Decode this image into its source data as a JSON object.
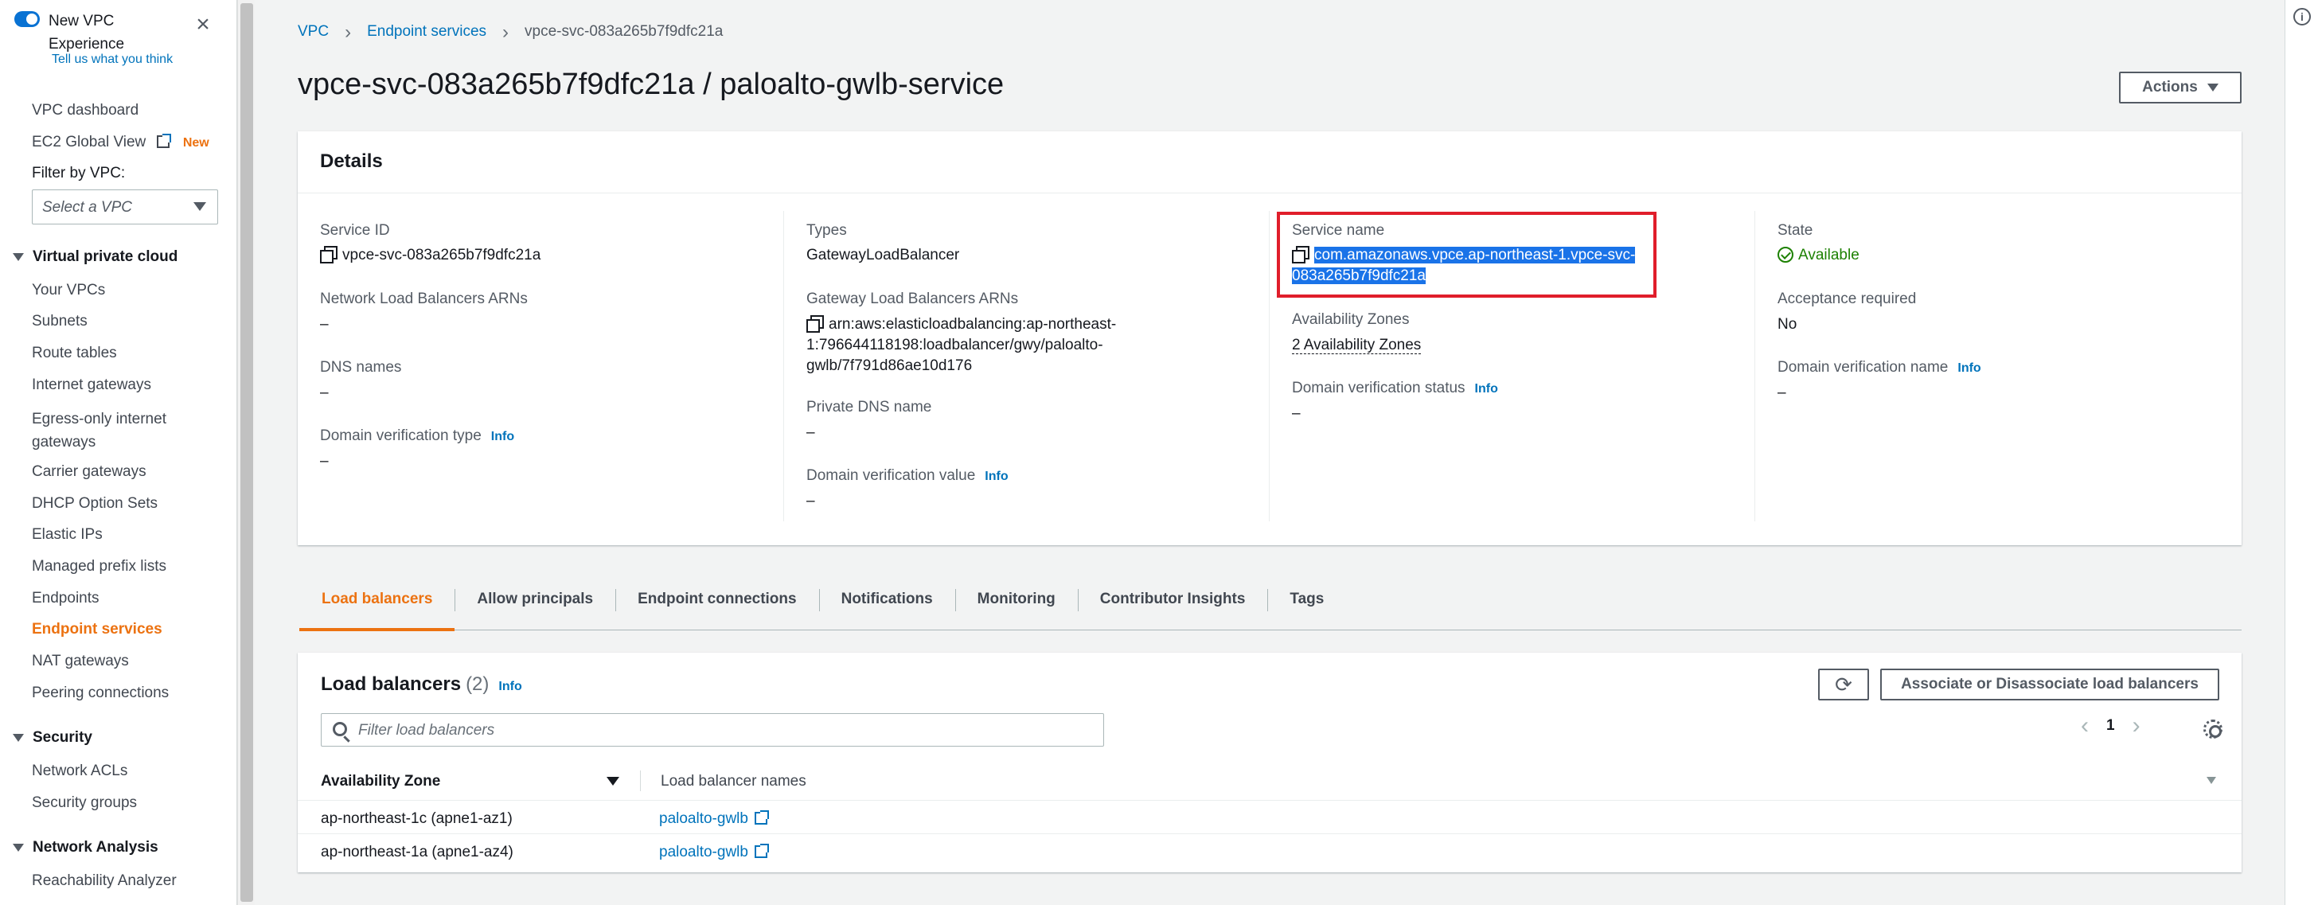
{
  "sidebar": {
    "toggle_label": "New VPC Experience",
    "feedback": "Tell us what you think",
    "items": {
      "dashboard": "VPC dashboard",
      "ec2_global": "EC2 Global View",
      "new_badge": "New",
      "filter_label": "Filter by VPC:",
      "filter_placeholder": "Select a VPC",
      "section_vpc": "Virtual private cloud",
      "your_vpcs": "Your VPCs",
      "subnets": "Subnets",
      "route_tables": "Route tables",
      "igw": "Internet gateways",
      "egress_igw": "Egress-only internet gateways",
      "carrier": "Carrier gateways",
      "dhcp": "DHCP Option Sets",
      "eips": "Elastic IPs",
      "prefix": "Managed prefix lists",
      "endpoints": "Endpoints",
      "endpoint_services": "Endpoint services",
      "nat": "NAT gateways",
      "peering": "Peering connections",
      "section_security": "Security",
      "nacls": "Network ACLs",
      "sgs": "Security groups",
      "section_network": "Network Analysis",
      "reachability": "Reachability Analyzer"
    }
  },
  "breadcrumb": {
    "vpc": "VPC",
    "endpoint_services": "Endpoint services",
    "current": "vpce-svc-083a265b7f9dfc21a"
  },
  "page_title": "vpce-svc-083a265b7f9dfc21a / paloalto-gwlb-service",
  "actions_label": "Actions",
  "details": {
    "header": "Details",
    "info": "Info",
    "service_id_label": "Service ID",
    "service_id": "vpce-svc-083a265b7f9dfc21a",
    "nlb_arns_label": "Network Load Balancers ARNs",
    "nlb_arns": "–",
    "dns_names_label": "DNS names",
    "dns_names": "–",
    "dv_type_label": "Domain verification type",
    "dv_type": "–",
    "types_label": "Types",
    "types": "GatewayLoadBalancer",
    "gwlb_arns_label": "Gateway Load Balancers ARNs",
    "gwlb_arns_1": "arn:aws:elasticloadbalancing:ap-northeast-",
    "gwlb_arns_2": "1:796644118198:loadbalancer/gwy/paloalto-",
    "gwlb_arns_3": "gwlb/7f791d86ae10d176",
    "private_dns_label": "Private DNS name",
    "private_dns": "–",
    "dv_value_label": "Domain verification value",
    "dv_value": "–",
    "service_name_label": "Service name",
    "service_name_1": "com.amazonaws.vpce.ap-northeast-1.vpce-svc-",
    "service_name_2": "083a265b7f9dfc21a",
    "az_label": "Availability Zones",
    "az": "2 Availability Zones",
    "dv_status_label": "Domain verification status",
    "dv_status": "–",
    "state_label": "State",
    "state": "Available",
    "acceptance_label": "Acceptance required",
    "acceptance": "No",
    "dv_name_label": "Domain verification name",
    "dv_name": "–"
  },
  "tabs": [
    "Load balancers",
    "Allow principals",
    "Endpoint connections",
    "Notifications",
    "Monitoring",
    "Contributor Insights",
    "Tags"
  ],
  "lb": {
    "title": "Load balancers",
    "count": "(2)",
    "info": "Info",
    "associate_label": "Associate or Disassociate load balancers",
    "search_placeholder": "Filter load balancers",
    "page": "1",
    "col_az": "Availability Zone",
    "col_names": "Load balancer names",
    "rows": [
      {
        "az": "ap-northeast-1c (apne1-az1)",
        "name": "paloalto-gwlb"
      },
      {
        "az": "ap-northeast-1a (apne1-az4)",
        "name": "paloalto-gwlb"
      }
    ]
  },
  "colors": {
    "accent": "#ec7211",
    "link": "#0073bb",
    "selection": "#1a73e8",
    "highlight_box": "#e01e2b",
    "success": "#1d8102"
  }
}
